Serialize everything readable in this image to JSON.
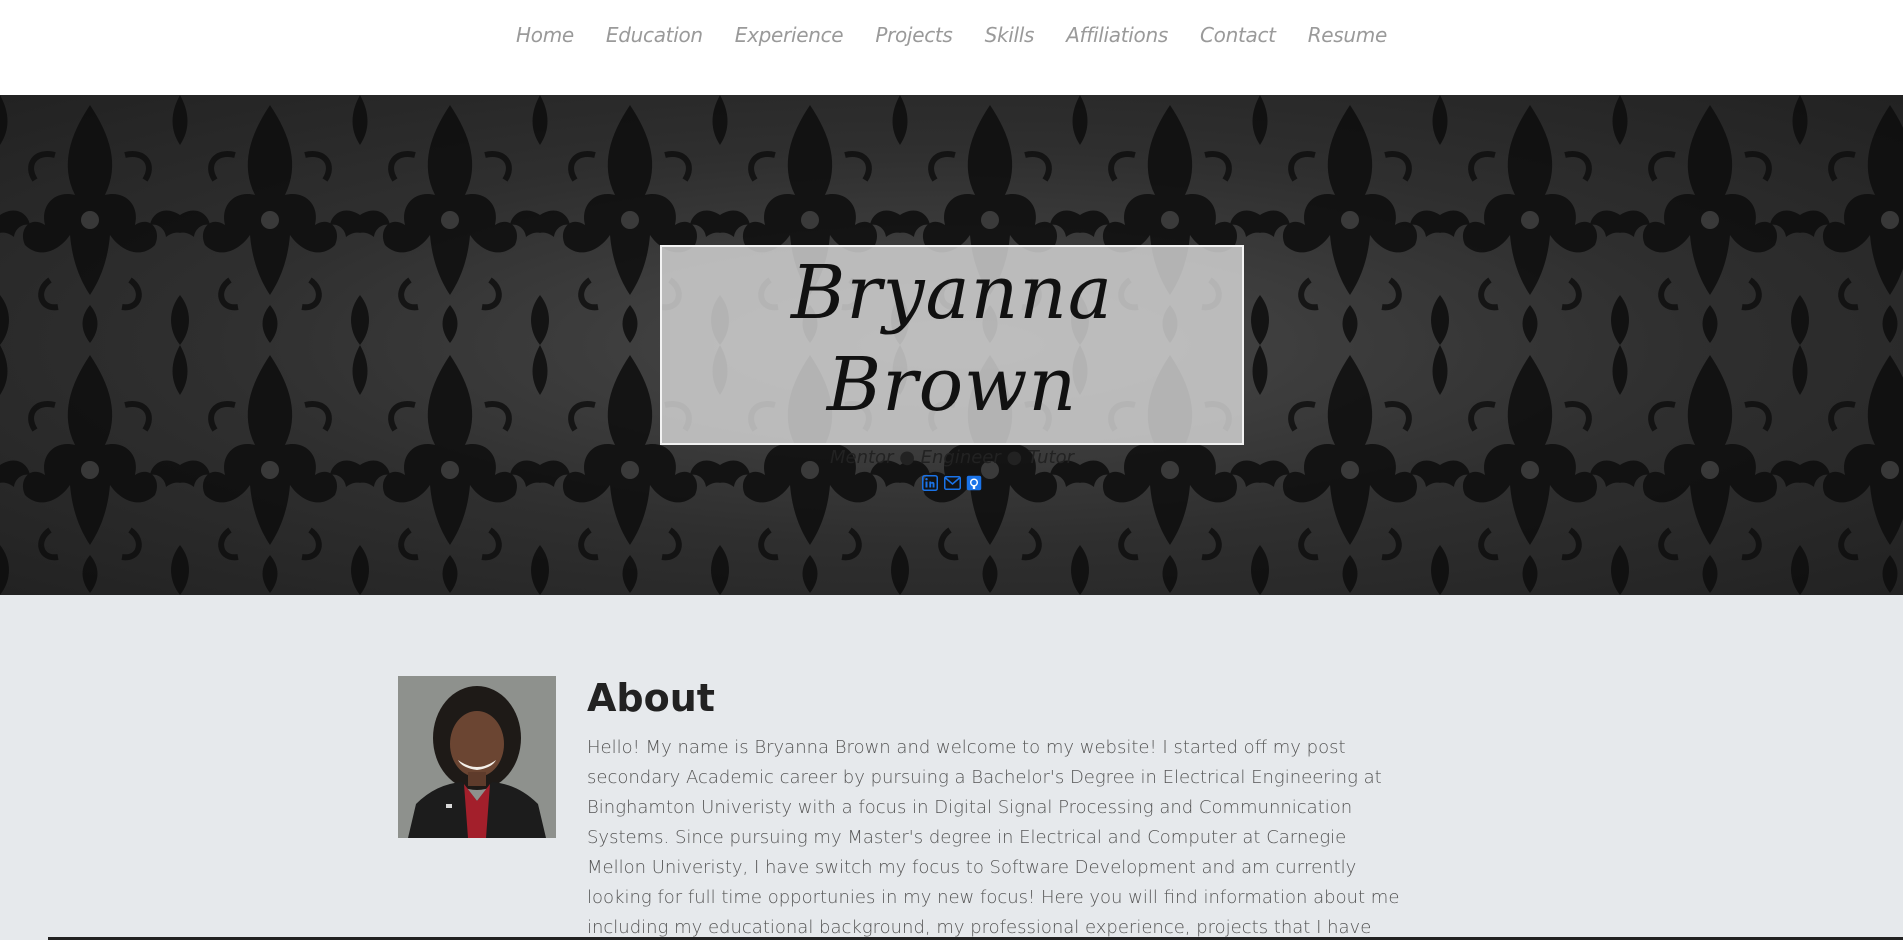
{
  "nav": {
    "items": [
      "Home",
      "Education",
      "Experience",
      "Projects",
      "Skills",
      "Affiliations",
      "Contact",
      "Resume"
    ]
  },
  "hero": {
    "name": "Bryanna Brown",
    "tagline": "Mentor ● Engineer ● Tutor",
    "social_icons": [
      "linkedin-icon",
      "mail-icon",
      "github-icon"
    ],
    "icon_color": "#1a73e8"
  },
  "about": {
    "title": "About",
    "photo_alt": "profile-photo",
    "text": "Hello! My name is Bryanna Brown and welcome to my website! I started off my post secondary Academic career by pursuing a Bachelor's Degree in Electrical Engineering at Binghamton Univeristy with a focus in Digital Signal Processing and Communnication Systems. Since pursuing my Master's degree in Electrical and Computer at Carnegie Mellon Univeristy, I have switch my focus to Software Development and am currently looking for full time opportunies in my new focus! Here you will find information about me including my educational background, my professional experience, projects that I have done, some of my relevant skills, my affiliations and"
  }
}
